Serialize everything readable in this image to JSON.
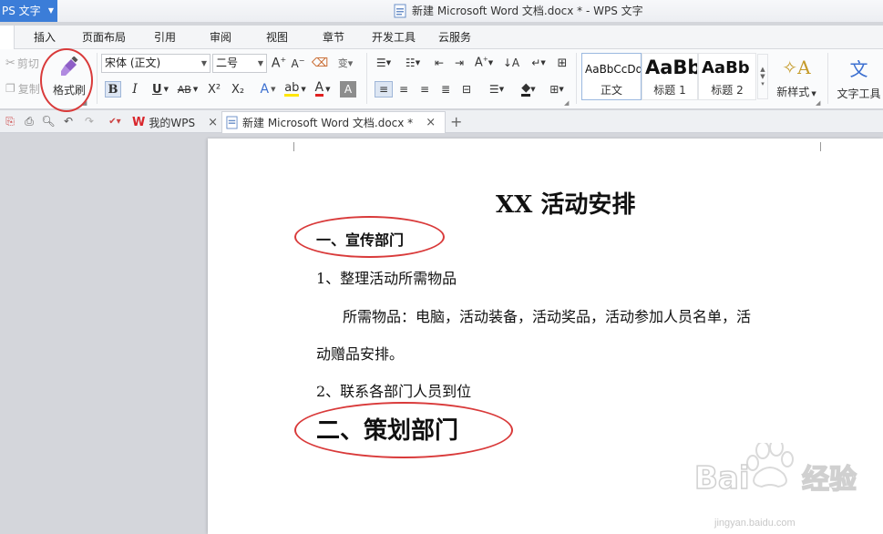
{
  "title_bar": {
    "app_badge": "PS 文字",
    "document_title": "新建 Microsoft Word 文档.docx * - WPS 文字"
  },
  "menu": {
    "tabs": [
      "插入",
      "页面布局",
      "引用",
      "审阅",
      "视图",
      "章节",
      "开发工具",
      "云服务"
    ]
  },
  "ribbon": {
    "cut_label": "剪切",
    "copy_label": "复制",
    "format_painter_label": "格式刷",
    "font_name": "宋体 (正文)",
    "font_size": "二号",
    "bold": "B",
    "italic": "I",
    "underline": "U",
    "strikethrough": "AB",
    "superscript": "X²",
    "subscript": "X₂",
    "styles": [
      {
        "sample": "AaBbCcDd",
        "label": "正文"
      },
      {
        "sample": "AaBb",
        "label": "标题 1"
      },
      {
        "sample": "AaBb",
        "label": "标题 2"
      }
    ],
    "new_style_label": "新样式",
    "text_tools_label": "文字工具"
  },
  "doc_tabs": {
    "tabs": [
      {
        "label": "我的WPS"
      },
      {
        "label": "新建 Microsoft Word 文档.docx *"
      }
    ]
  },
  "document": {
    "heading": "XX 活动安排",
    "section1": "一、宣传部门",
    "item1": "1、整理活动所需物品",
    "paragraph_line1": "所需物品：电脑，活动装备，活动奖品，活动参加人员名单，活",
    "paragraph_line2": "动赠品安排。",
    "item2": "2、联系各部门人员到位",
    "section2": "二、策划部门"
  },
  "watermark": {
    "brand": "Bai",
    "brand_suffix": "经验",
    "url": "jingyan.baidu.com"
  },
  "colors": {
    "app_badge_bg": "#3b7dd8",
    "annotation_red": "#d93a3a",
    "wps_red": "#d9262c"
  }
}
